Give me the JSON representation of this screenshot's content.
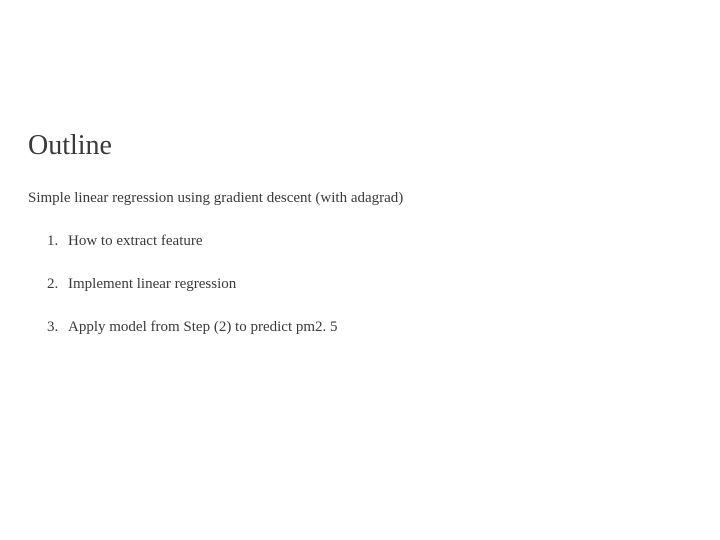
{
  "title": "Outline",
  "subtitle": "Simple linear regression using gradient descent (with adagrad)",
  "steps": {
    "0": "How to extract feature",
    "1": "Implement linear regression",
    "2": "Apply model from Step (2) to predict pm2. 5"
  }
}
